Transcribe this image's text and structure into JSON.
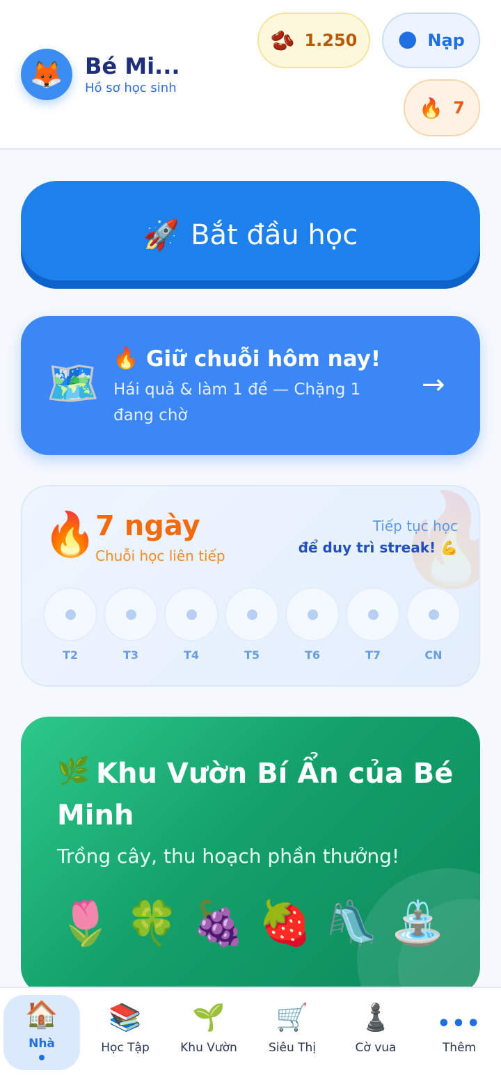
{
  "header": {
    "avatar_emoji": "🦊",
    "name": "Bé Mi...",
    "subtitle": "Hồ sơ học sinh",
    "beans": {
      "icon": "🫘",
      "value": "1.250"
    },
    "topup": {
      "icon": "🌑",
      "label": "Nạp"
    },
    "streak": {
      "icon": "🔥",
      "value": "7"
    }
  },
  "start_button": {
    "icon": "🚀",
    "label": "Bắt đầu học"
  },
  "streak_reminder": {
    "map_icon": "🗺️",
    "fire_icon": "🔥",
    "title": "Giữ chuỗi hôm nay!",
    "description": "Hái quả & làm 1 đề — Chặng 1 đang chờ",
    "arrow": "→"
  },
  "streak_counter": {
    "fire_icon": "🔥",
    "days": "7 ngày",
    "subtitle": "Chuỗi học liên tiếp",
    "keep_line1": "Tiếp tục học",
    "keep_line2": "để duy trì streak! 💪",
    "weekdays": [
      "T2",
      "T3",
      "T4",
      "T5",
      "T6",
      "T7",
      "CN"
    ]
  },
  "garden": {
    "icon": "🌿",
    "title": "Khu Vườn Bí Ẩn của Bé Minh",
    "subtitle": "Trồng cây, thu hoạch phần thưởng!",
    "items": [
      "🌷",
      "🍀",
      "🍇",
      "🍓",
      "🛝",
      "⛲"
    ]
  },
  "nav": [
    {
      "icon": "🏠",
      "label": "Nhà",
      "active": true
    },
    {
      "icon": "📚",
      "label": "Học Tập"
    },
    {
      "icon": "🌱",
      "label": "Khu Vườn"
    },
    {
      "icon": "🛒",
      "label": "Siêu Thị"
    },
    {
      "icon": "♟️",
      "label": "Cờ vua"
    },
    {
      "icon": "•••",
      "label": "Thêm"
    }
  ],
  "colors": {
    "primary": "#1e80ea",
    "streak_orange": "#f26b0f",
    "garden_green": "#14a06b"
  }
}
